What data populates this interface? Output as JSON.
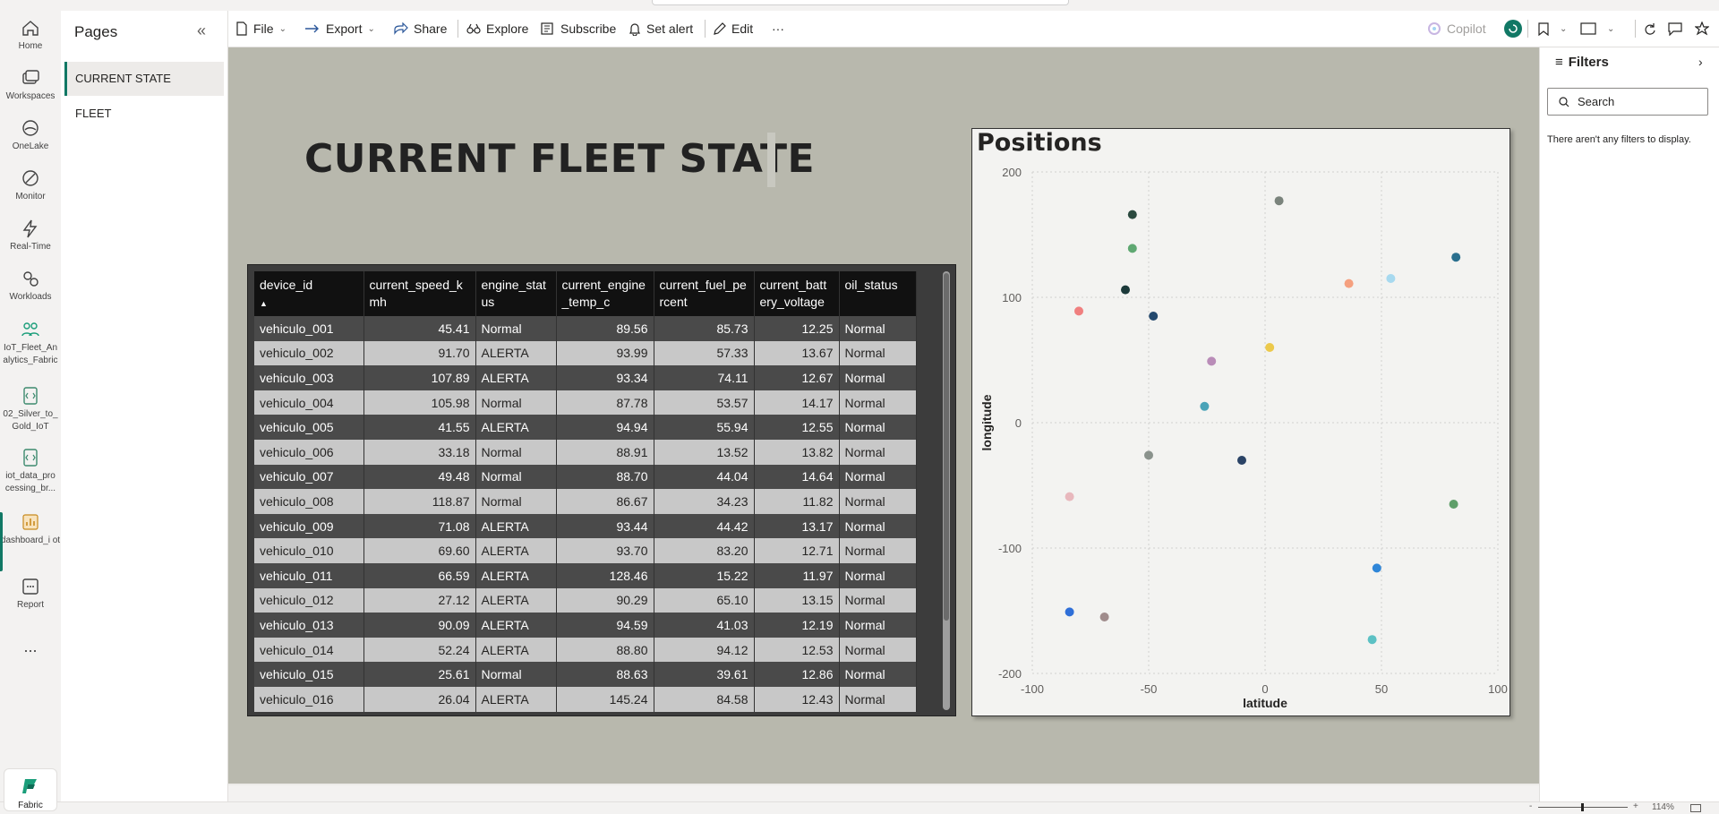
{
  "rail": [
    {
      "name": "home",
      "label": "Home",
      "icon": "home-icon"
    },
    {
      "name": "workspaces",
      "label": "Workspaces",
      "icon": "workspaces-icon"
    },
    {
      "name": "onelake",
      "label": "OneLake",
      "icon": "onelake-icon"
    },
    {
      "name": "monitor",
      "label": "Monitor",
      "icon": "monitor-icon"
    },
    {
      "name": "realtime",
      "label": "Real-Time",
      "icon": "lightning-icon"
    },
    {
      "name": "workloads",
      "label": "Workloads",
      "icon": "workloads-icon"
    },
    {
      "name": "iot",
      "label": "IoT_Fleet_An alytics_Fabric",
      "icon": "people-icon"
    },
    {
      "name": "silver",
      "label": "02_Silver_to_ Gold_IoT",
      "icon": "notebook-icon"
    },
    {
      "name": "iotdata",
      "label": "iot_data_pro cessing_br...",
      "icon": "notebook-icon"
    },
    {
      "name": "dashboard",
      "label": "dashboard_i ot",
      "icon": "report-icon"
    },
    {
      "name": "report",
      "label": "Report",
      "icon": "grid-icon"
    }
  ],
  "more_label": "...",
  "fabric_label": "Fabric",
  "pages": {
    "title": "Pages",
    "items": [
      {
        "label": "CURRENT STATE",
        "active": true
      },
      {
        "label": "FLEET",
        "active": false
      }
    ]
  },
  "toolbar": {
    "file": "File",
    "export": "Export",
    "share": "Share",
    "explore": "Explore",
    "subscribe": "Subscribe",
    "set_alert": "Set alert",
    "edit": "Edit",
    "more": "···",
    "copilot": "Copilot"
  },
  "report": {
    "title": "CURRENT FLEET STATE"
  },
  "table": {
    "columns": [
      "device_id",
      "current_speed_kmh",
      "engine_status",
      "current_engine_temp_c",
      "current_fuel_percent",
      "current_battery_voltage",
      "oil_status"
    ],
    "column_display": [
      "device_id",
      "current_speed_k mh",
      "engine_stat us",
      "current_engine _temp_c",
      "current_fuel_pe rcent",
      "current_batt ery_voltage",
      "oil_status"
    ],
    "rows": [
      [
        "vehiculo_001",
        "45.41",
        "Normal",
        "89.56",
        "85.73",
        "12.25",
        "Normal"
      ],
      [
        "vehiculo_002",
        "91.70",
        "ALERTA",
        "93.99",
        "57.33",
        "13.67",
        "Normal"
      ],
      [
        "vehiculo_003",
        "107.89",
        "ALERTA",
        "93.34",
        "74.11",
        "12.67",
        "Normal"
      ],
      [
        "vehiculo_004",
        "105.98",
        "Normal",
        "87.78",
        "53.57",
        "14.17",
        "Normal"
      ],
      [
        "vehiculo_005",
        "41.55",
        "ALERTA",
        "94.94",
        "55.94",
        "12.55",
        "Normal"
      ],
      [
        "vehiculo_006",
        "33.18",
        "Normal",
        "88.91",
        "13.52",
        "13.82",
        "Normal"
      ],
      [
        "vehiculo_007",
        "49.48",
        "Normal",
        "88.70",
        "44.04",
        "14.64",
        "Normal"
      ],
      [
        "vehiculo_008",
        "118.87",
        "Normal",
        "86.67",
        "34.23",
        "11.82",
        "Normal"
      ],
      [
        "vehiculo_009",
        "71.08",
        "ALERTA",
        "93.44",
        "44.42",
        "13.17",
        "Normal"
      ],
      [
        "vehiculo_010",
        "69.60",
        "ALERTA",
        "93.70",
        "83.20",
        "12.71",
        "Normal"
      ],
      [
        "vehiculo_011",
        "66.59",
        "ALERTA",
        "128.46",
        "15.22",
        "11.97",
        "Normal"
      ],
      [
        "vehiculo_012",
        "27.12",
        "ALERTA",
        "90.29",
        "65.10",
        "13.15",
        "Normal"
      ],
      [
        "vehiculo_013",
        "90.09",
        "ALERTA",
        "94.59",
        "41.03",
        "12.19",
        "Normal"
      ],
      [
        "vehiculo_014",
        "52.24",
        "ALERTA",
        "88.80",
        "94.12",
        "12.53",
        "Normal"
      ],
      [
        "vehiculo_015",
        "25.61",
        "Normal",
        "88.63",
        "39.61",
        "12.86",
        "Normal"
      ],
      [
        "vehiculo_016",
        "26.04",
        "ALERTA",
        "145.24",
        "84.58",
        "12.43",
        "Normal"
      ]
    ]
  },
  "chart_data": {
    "type": "scatter",
    "title": "Positions",
    "xlabel": "latitude",
    "ylabel": "longitude",
    "xlim": [
      -100,
      100
    ],
    "ylim": [
      -200,
      200
    ],
    "xticks": [
      "-100",
      "-50",
      "0",
      "50",
      "100"
    ],
    "yticks": [
      "200",
      "100",
      "0",
      "-100",
      "-200"
    ],
    "grid": true,
    "points": [
      {
        "x": -57,
        "y": 166,
        "color": "#2b4a3f"
      },
      {
        "x": 6,
        "y": 177,
        "color": "#7a837c"
      },
      {
        "x": -57,
        "y": 139,
        "color": "#5fa872"
      },
      {
        "x": 82,
        "y": 132,
        "color": "#2a6f8e"
      },
      {
        "x": 54,
        "y": 115,
        "color": "#a7d9ef"
      },
      {
        "x": 36,
        "y": 111,
        "color": "#f5a07f"
      },
      {
        "x": -60,
        "y": 106,
        "color": "#1c3a3a"
      },
      {
        "x": -80,
        "y": 89,
        "color": "#f07f7f"
      },
      {
        "x": -48,
        "y": 85,
        "color": "#24496e"
      },
      {
        "x": 2,
        "y": 60,
        "color": "#ecc94b"
      },
      {
        "x": -23,
        "y": 49,
        "color": "#b98cb8"
      },
      {
        "x": -26,
        "y": 13,
        "color": "#4aa3b8"
      },
      {
        "x": -50,
        "y": -26,
        "color": "#8a928c"
      },
      {
        "x": -10,
        "y": -30,
        "color": "#2a4366"
      },
      {
        "x": -84,
        "y": -59,
        "color": "#e8b8bd"
      },
      {
        "x": 81,
        "y": -65,
        "color": "#5f9f6a"
      },
      {
        "x": 48,
        "y": -116,
        "color": "#2f86d8"
      },
      {
        "x": -84,
        "y": -151,
        "color": "#2f6fd8"
      },
      {
        "x": -69,
        "y": -155,
        "color": "#a08c8c"
      },
      {
        "x": 46,
        "y": -173,
        "color": "#5cc1c4"
      }
    ]
  },
  "filters": {
    "title": "Filters",
    "search_placeholder": "Search",
    "empty_text": "There aren't any filters to display."
  },
  "status": {
    "zoom": "114%",
    "minus": "-",
    "plus": "+"
  }
}
